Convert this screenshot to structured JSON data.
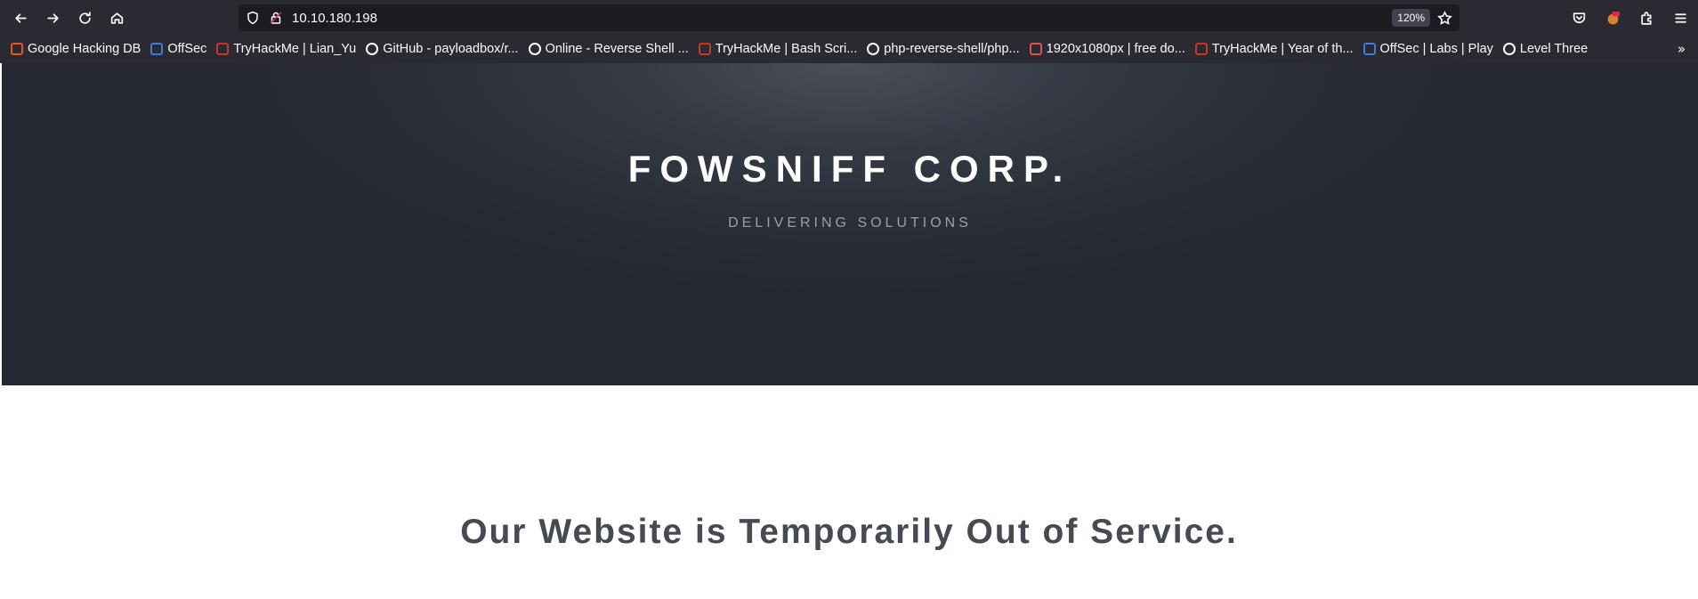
{
  "browser": {
    "url": "10.10.180.198",
    "zoom": "120%",
    "bookmarks": [
      {
        "label": "Google Hacking DB",
        "icon": "exploit-db-icon",
        "color": "#e25822"
      },
      {
        "label": "OffSec",
        "icon": "offsec-icon",
        "color": "#3d7dd8"
      },
      {
        "label": "TryHackMe | Lian_Yu",
        "icon": "tryhackme-icon",
        "color": "#c0392b"
      },
      {
        "label": "GitHub - payloadbox/r...",
        "icon": "github-icon",
        "color": "#fbfbfe"
      },
      {
        "label": "Online - Reverse Shell ...",
        "icon": "skull-icon",
        "color": "#fbfbfe"
      },
      {
        "label": "TryHackMe | Bash Scri...",
        "icon": "tryhackme-icon",
        "color": "#c0392b"
      },
      {
        "label": "php-reverse-shell/php...",
        "icon": "github-icon",
        "color": "#fbfbfe"
      },
      {
        "label": "1920x1080px | free do...",
        "icon": "wallpaper-icon",
        "color": "#d9534f"
      },
      {
        "label": "TryHackMe | Year of th...",
        "icon": "tryhackme-icon",
        "color": "#c0392b"
      },
      {
        "label": "OffSec | Labs | Play",
        "icon": "offsec-icon",
        "color": "#3d7dd8"
      },
      {
        "label": "Level Three",
        "icon": "globe-icon",
        "color": "#fbfbfe"
      }
    ]
  },
  "page": {
    "brand": "FOWSNIFF CORP.",
    "tagline": "DELIVERING SOLUTIONS",
    "headline": "Our Website is Temporarily Out of Service."
  }
}
